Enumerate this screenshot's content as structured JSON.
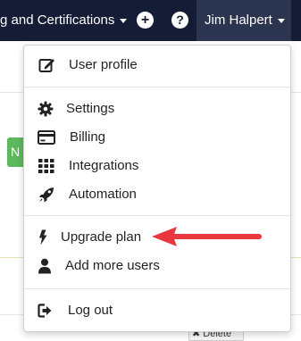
{
  "navbar": {
    "left_menu_label": "g and Certifications",
    "user_name": "Jim Halpert"
  },
  "menu": {
    "user_profile": "User profile",
    "settings": "Settings",
    "billing": "Billing",
    "integrations": "Integrations",
    "automation": "Automation",
    "upgrade_plan": "Upgrade plan",
    "add_users": "Add more users",
    "log_out": "Log out"
  },
  "background": {
    "button_partial": "N",
    "delete_label": "Delete"
  },
  "colors": {
    "navbar": "#141d35",
    "user_button": "#2b3550",
    "annotation_arrow": "#e8373e"
  },
  "icons": [
    "edit-icon",
    "gear-icon",
    "credit-card-icon",
    "grid-icon",
    "rocket-icon",
    "bolt-icon",
    "user-icon",
    "sign-out-icon"
  ]
}
